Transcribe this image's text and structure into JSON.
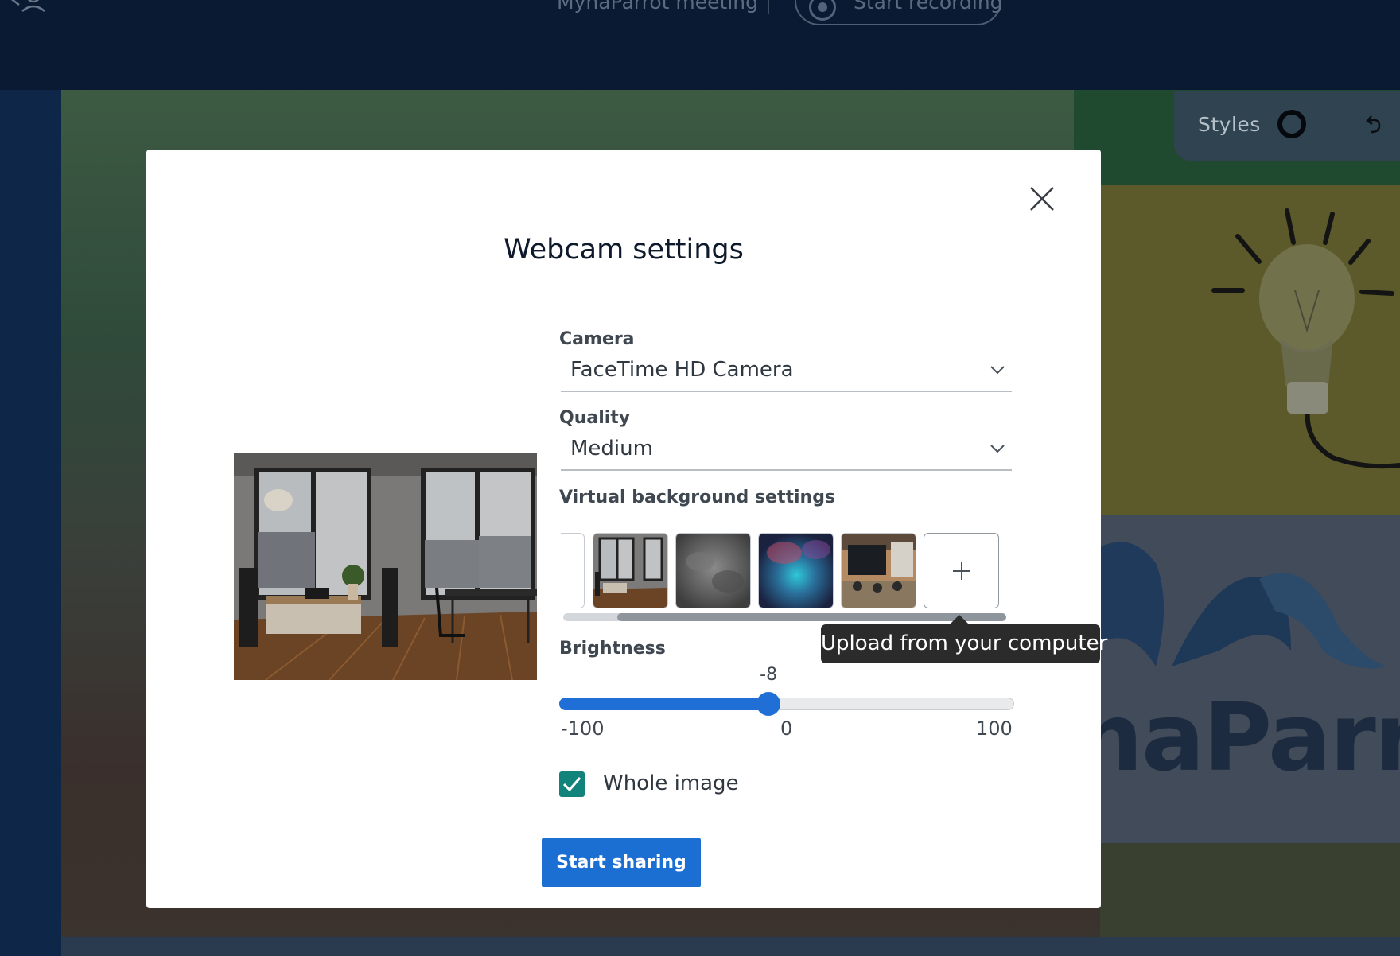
{
  "background": {
    "meeting_title": "MynaParrot meeting",
    "recording_button_label": "Start recording",
    "styles_label": "Styles",
    "slide_logo_text": "naParro"
  },
  "modal": {
    "title": "Webcam settings",
    "camera": {
      "label": "Camera",
      "value": "FaceTime HD Camera"
    },
    "quality": {
      "label": "Quality",
      "value": "Medium"
    },
    "virtual_background": {
      "label": "Virtual background settings",
      "upload_tooltip": "Upload from your computer"
    },
    "brightness": {
      "label": "Brightness",
      "value": -8,
      "value_label": "-8",
      "min": -100,
      "max": 100,
      "min_label": "-100",
      "mid_label": "0",
      "max_label": "100"
    },
    "whole_image": {
      "label": "Whole image",
      "checked": true
    },
    "start_button_label": "Start sharing"
  },
  "icons": {
    "close": "close-icon",
    "chevron": "chevron-down-icon",
    "upload": "plus-icon",
    "check": "check-icon"
  },
  "colors": {
    "accent_blue": "#1b6fd3",
    "checkbox_teal": "#12837a",
    "tooltip_bg": "#2b2b2b"
  }
}
